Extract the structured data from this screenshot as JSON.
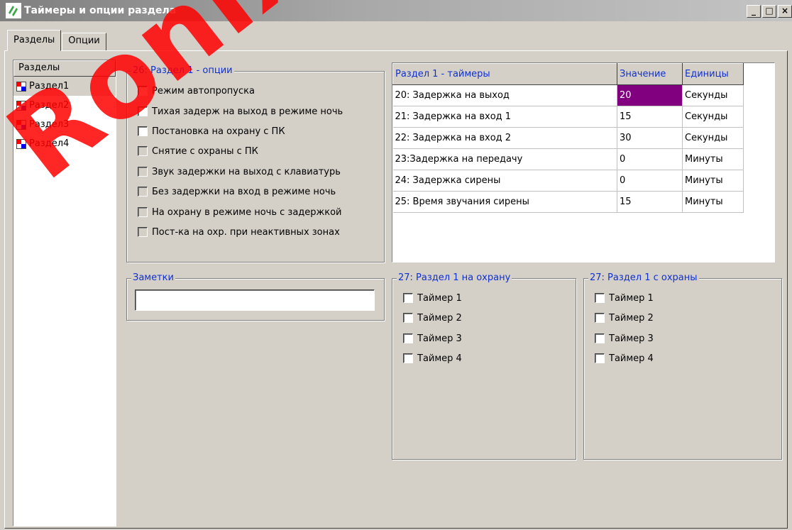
{
  "window": {
    "title": "Таймеры и опции раздела",
    "minimize": "_",
    "maximize": "□",
    "close": "×"
  },
  "tabs": [
    {
      "label": "Разделы"
    },
    {
      "label": "Опции"
    }
  ],
  "sections_list": {
    "header": "Разделы",
    "items": [
      {
        "label": "Раздел1"
      },
      {
        "label": "Раздел2"
      },
      {
        "label": "Раздел3"
      },
      {
        "label": "Раздел4"
      }
    ]
  },
  "options": {
    "legend": "26: Раздел 1 - опции",
    "items": [
      {
        "label": "Режим автопропуска"
      },
      {
        "label": "Тихая задерж на выход в режиме ночь"
      },
      {
        "label": "Постановка на охрану с ПК"
      },
      {
        "label": "Снятие с охраны с ПК"
      },
      {
        "label": "Звук задержки на выход с клавиатурь"
      },
      {
        "label": "Без задержки на вход в режиме ночь"
      },
      {
        "label": "На охрану в режиме ночь с задержкой"
      },
      {
        "label": "Пост-ка на охр. при неактивных зонах"
      }
    ]
  },
  "timers_table": {
    "columns": [
      "Раздел 1 - таймеры",
      "Значение",
      "Единицы"
    ],
    "rows": [
      {
        "name": "20: Задержка на выход",
        "value": "20",
        "unit": "Секунды"
      },
      {
        "name": "21: Задержка на вход 1",
        "value": "15",
        "unit": "Секунды"
      },
      {
        "name": "22: Задержка на вход 2",
        "value": "30",
        "unit": "Секунды"
      },
      {
        "name": "23:Задержка на передачу",
        "value": "0",
        "unit": "Минуты"
      },
      {
        "name": "24: Задержка сирены",
        "value": "0",
        "unit": "Минуты"
      },
      {
        "name": "25: Время звучания сирены",
        "value": "15",
        "unit": "Минуты"
      }
    ]
  },
  "notes": {
    "legend": "Заметки",
    "value": ""
  },
  "arm": {
    "legend": "27: Раздел 1 на охрану",
    "items": [
      {
        "label": "Таймер 1"
      },
      {
        "label": "Таймер 2"
      },
      {
        "label": "Таймер 3"
      },
      {
        "label": "Таймер 4"
      }
    ]
  },
  "disarm": {
    "legend": "27: Раздел 1 с охраны",
    "items": [
      {
        "label": "Таймер 1"
      },
      {
        "label": "Таймер 2"
      },
      {
        "label": "Таймер 3"
      },
      {
        "label": "Таймер 4"
      }
    ]
  },
  "watermark": "Ronix",
  "colors": {
    "legend_text": "#1030d0",
    "selected_cell": "#800080",
    "icon_red": "#ff0000",
    "icon_blue": "#0000ff"
  }
}
